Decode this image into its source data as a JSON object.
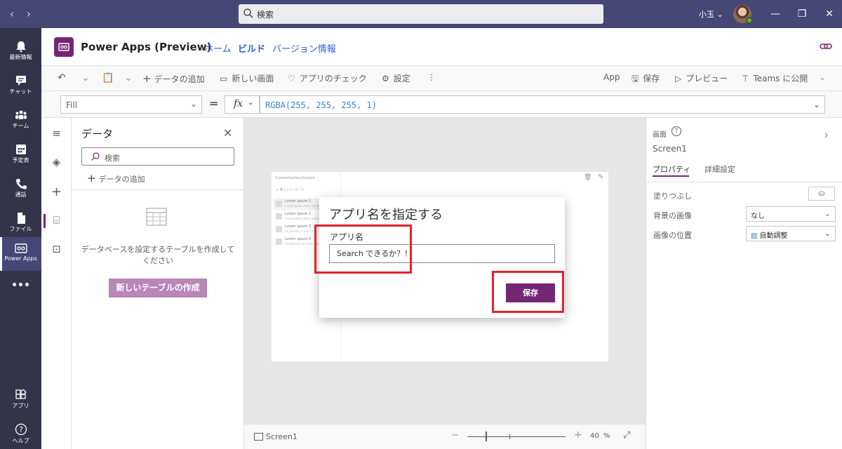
{
  "titlebar": {
    "search_text": "検索",
    "user_name": "小玉 ⌄",
    "icons": [
      "chevron-left-icon",
      "chevron-right-icon",
      "search-icon",
      "minimize-icon",
      "restore-icon",
      "close-icon"
    ]
  },
  "rail": {
    "items": [
      {
        "label": "最新情報",
        "icon": "bell-icon"
      },
      {
        "label": "チャット",
        "icon": "chat-icon"
      },
      {
        "label": "チーム",
        "icon": "teams-icon"
      },
      {
        "label": "予定表",
        "icon": "calendar-icon"
      },
      {
        "label": "通話",
        "icon": "phone-icon"
      },
      {
        "label": "ファイル",
        "icon": "file-icon"
      },
      {
        "label": "Power Apps",
        "icon": "power-apps-icon"
      },
      {
        "label": "•••",
        "icon": "more-icon"
      },
      {
        "label": "アプリ",
        "icon": "apps-icon"
      },
      {
        "label": "ヘルプ",
        "icon": "help-icon"
      }
    ]
  },
  "header": {
    "title": "Power Apps (Preview)",
    "links": [
      "ホーム",
      "ビルド",
      "バージョン情報"
    ]
  },
  "commandbar": {
    "add_data": "データの追加",
    "new_screen": "新しい画面",
    "app_check": "アプリのチェック",
    "settings": "設定",
    "app": "App",
    "save": "保存",
    "preview": "プレビュー",
    "publish_teams": "Teams に公開"
  },
  "formula": {
    "property": "Fill",
    "equals": "=",
    "fx": "fx",
    "expression": "RGBA(255, 255, 255, 1)"
  },
  "data_panel": {
    "title": "データ",
    "search_placeholder": "検索",
    "add_data": "データの追加",
    "message": "データベースを設定するテーブルを作成してください",
    "create_table": "新しいテーブルの作成"
  },
  "preview": {
    "title": "CustomGallerySample",
    "new_record": "新しいレコード",
    "rows": [
      {
        "title": "Lorem ipsum 1",
        "sub": "Lorem ipsum dolor sit amet"
      },
      {
        "title": "Lorem ipsum 2",
        "sub": "Suspendisse dolor metus"
      },
      {
        "title": "Lorem ipsum 3",
        "sub": "Ut gravida a dolor at"
      },
      {
        "title": "Lorem ipsum 4",
        "sub": "Vestibulum dui felis, lobortis"
      }
    ]
  },
  "dialog": {
    "title": "アプリ名を指定する",
    "field_label": "アプリ名",
    "field_value": "Search できるか？！",
    "save": "保存"
  },
  "bottombar": {
    "screen": "Screen1",
    "zoom": "40",
    "zoom_unit": "%",
    "zoom_fraction": 0.19
  },
  "properties": {
    "kind": "画面",
    "name": "Screen1",
    "tabs": [
      "プロパティ",
      "詳細設定"
    ],
    "fill_label": "塗りつぶし",
    "bg_image_label": "背景の画像",
    "bg_image_value": "なし",
    "image_pos_label": "画像の位置",
    "image_pos_value": "自動調整"
  },
  "colors": {
    "titlebar": "#464775",
    "rail": "#33344a",
    "accent": "#742774",
    "highlight": "#e0232e",
    "link": "#2b5fd9"
  }
}
